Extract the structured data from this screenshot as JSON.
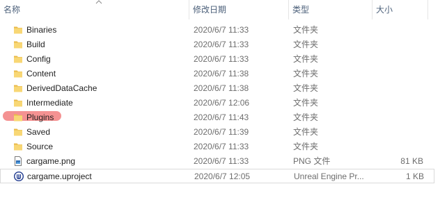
{
  "columns": {
    "name": "名称",
    "date": "修改日期",
    "type": "类型",
    "size": "大小"
  },
  "files": [
    {
      "name": "Binaries",
      "date": "2020/6/7 11:33",
      "type": "文件夹",
      "size": "",
      "icon": "folder-icon"
    },
    {
      "name": "Build",
      "date": "2020/6/7 11:33",
      "type": "文件夹",
      "size": "",
      "icon": "folder-icon"
    },
    {
      "name": "Config",
      "date": "2020/6/7 11:33",
      "type": "文件夹",
      "size": "",
      "icon": "folder-icon"
    },
    {
      "name": "Content",
      "date": "2020/6/7 11:38",
      "type": "文件夹",
      "size": "",
      "icon": "folder-icon"
    },
    {
      "name": "DerivedDataCache",
      "date": "2020/6/7 11:38",
      "type": "文件夹",
      "size": "",
      "icon": "folder-icon"
    },
    {
      "name": "Intermediate",
      "date": "2020/6/7 12:06",
      "type": "文件夹",
      "size": "",
      "icon": "folder-icon"
    },
    {
      "name": "Plugins",
      "date": "2020/6/7 11:43",
      "type": "文件夹",
      "size": "",
      "icon": "folder-icon",
      "highlighted": true
    },
    {
      "name": "Saved",
      "date": "2020/6/7 11:39",
      "type": "文件夹",
      "size": "",
      "icon": "folder-icon"
    },
    {
      "name": "Source",
      "date": "2020/6/7 11:33",
      "type": "文件夹",
      "size": "",
      "icon": "folder-icon"
    },
    {
      "name": "cargame.png",
      "date": "2020/6/7 11:33",
      "type": "PNG 文件",
      "size": "81 KB",
      "icon": "png-file-icon"
    },
    {
      "name": "cargame.uproject",
      "date": "2020/6/7 12:05",
      "type": "Unreal Engine Pr...",
      "size": "1 KB",
      "icon": "unreal-project-icon",
      "selected": true
    }
  ],
  "colors": {
    "folder": "#f8d775",
    "folder_dark": "#e9b949",
    "highlight": "#f06e6e",
    "header_text": "#4c607a",
    "muted_text": "#6d6d6d"
  }
}
